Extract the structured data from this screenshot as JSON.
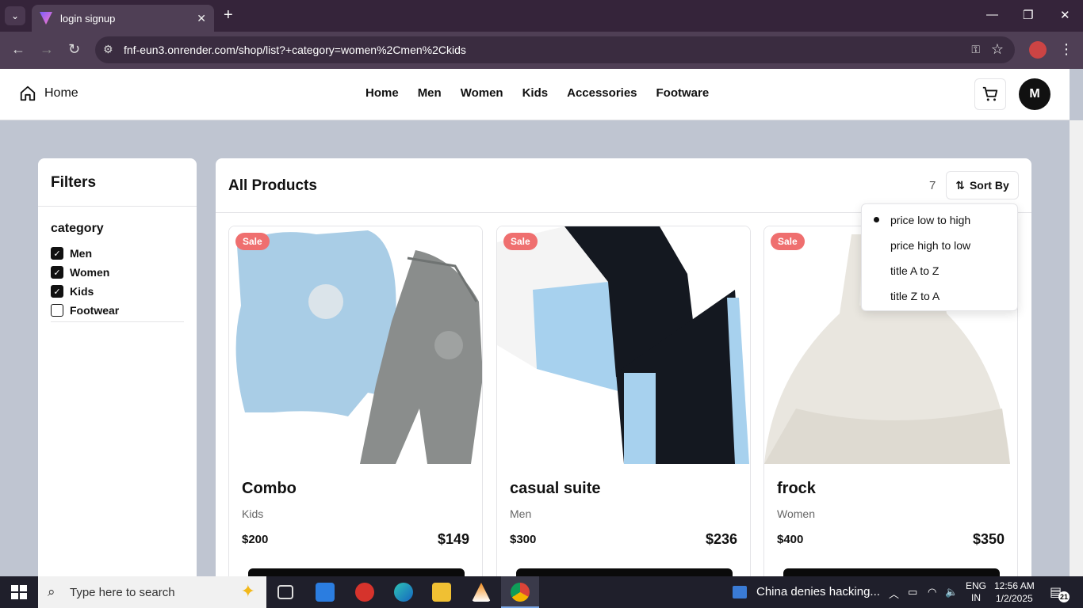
{
  "browser": {
    "tab_title": "login signup",
    "url": "fnf-eun3.onrender.com/shop/list?+category=women%2Cmen%2Ckids"
  },
  "header": {
    "home_label": "Home",
    "nav": [
      "Home",
      "Men",
      "Women",
      "Kids",
      "Accessories",
      "Footware"
    ],
    "avatar_letter": "M"
  },
  "filters": {
    "title": "Filters",
    "group_title": "category",
    "options": [
      {
        "label": "Men",
        "checked": true
      },
      {
        "label": "Women",
        "checked": true
      },
      {
        "label": "Kids",
        "checked": true
      },
      {
        "label": "Footwear",
        "checked": false
      }
    ]
  },
  "products": {
    "title": "All Products",
    "count": "7",
    "sort_label": "Sort By",
    "sort_options": [
      "price low to high",
      "price high to low",
      "title A to Z",
      "title Z to A"
    ],
    "sort_selected": "price low to high",
    "items": [
      {
        "name": "Combo",
        "category": "Kids",
        "price": "$200",
        "sale_price": "$149",
        "badge": "Sale"
      },
      {
        "name": "casual suite",
        "category": "Men",
        "price": "$300",
        "sale_price": "$236",
        "badge": "Sale"
      },
      {
        "name": "frock",
        "category": "Women",
        "price": "$400",
        "sale_price": "$350",
        "badge": "Sale"
      }
    ]
  },
  "taskbar": {
    "search_placeholder": "Type here to search",
    "news": "China denies hacking...",
    "lang_line1": "ENG",
    "lang_line2": "IN",
    "time": "12:56 AM",
    "date": "1/2/2025",
    "notifications": "21"
  },
  "colors": {
    "page_bg": "#bfc5d1",
    "browser_tab_bg": "#35243a",
    "address_bar_bg": "#4f3f55",
    "sale_badge": "#ef6f6f",
    "dark": "#0a0a0a"
  }
}
